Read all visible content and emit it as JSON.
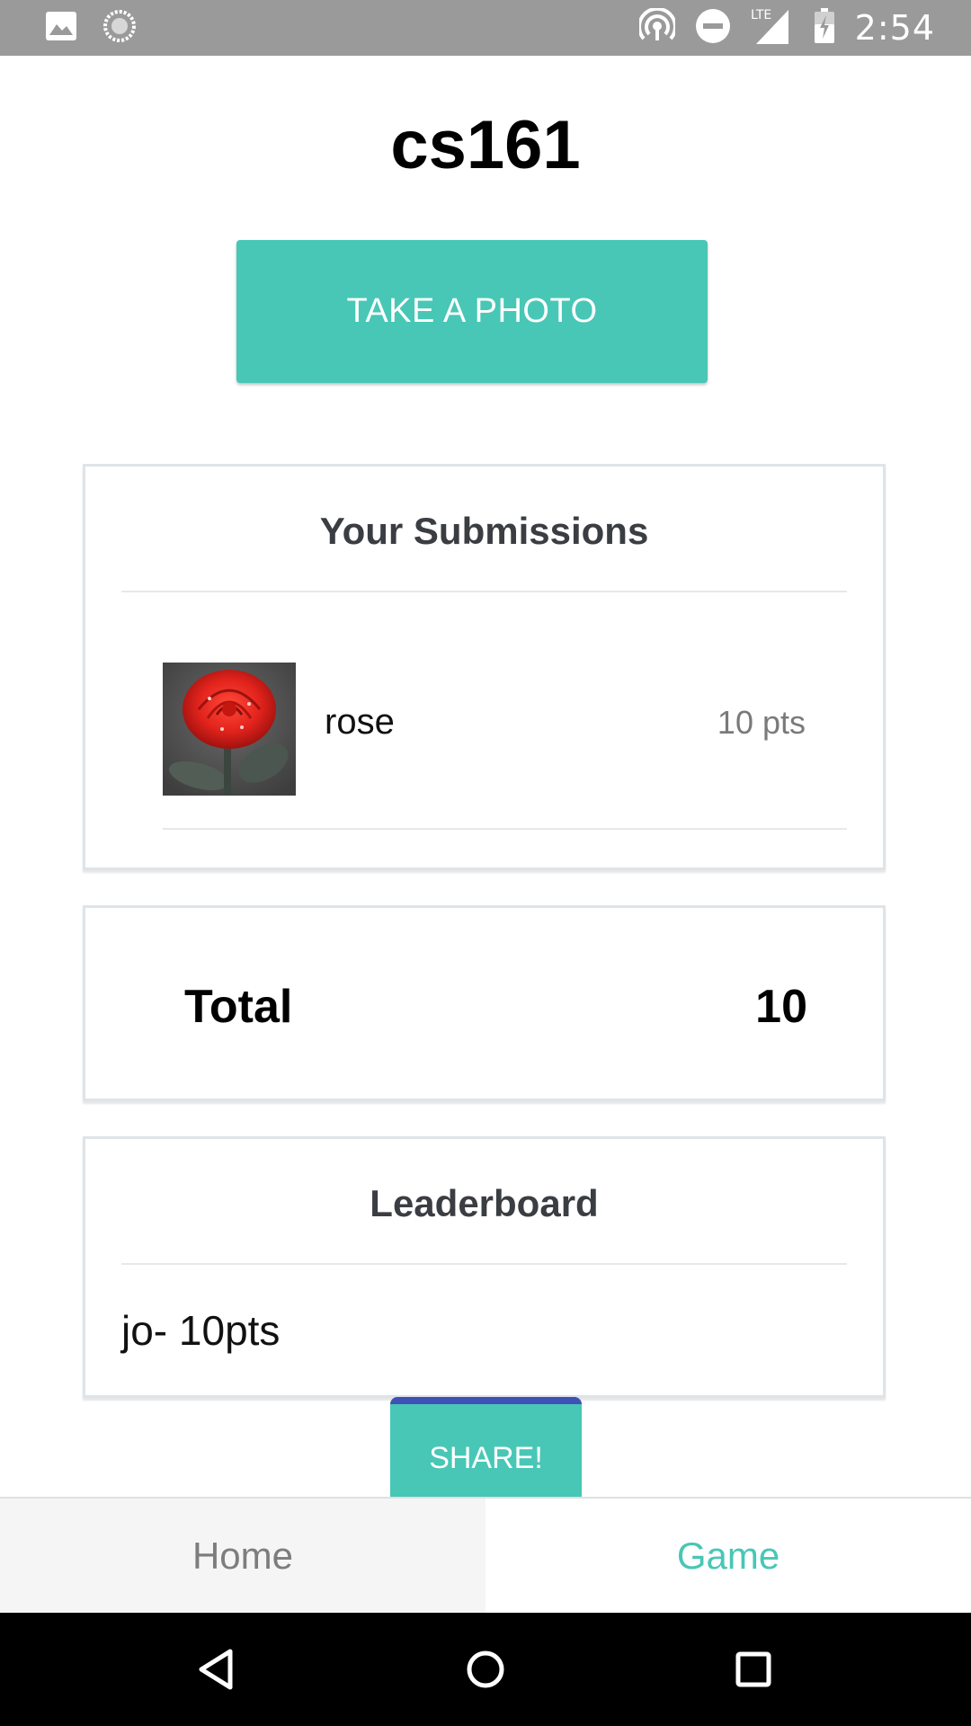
{
  "status_bar": {
    "time": "2:54",
    "network_label": "LTE",
    "left_icons": [
      "image-icon",
      "sync-icon"
    ],
    "right_icons": [
      "hotspot-icon",
      "dnd-icon",
      "signal-icon",
      "battery-icon"
    ]
  },
  "title": "cs161",
  "take_photo_label": "TAKE A PHOTO",
  "submissions": {
    "title": "Your Submissions",
    "items": [
      {
        "name": "rose",
        "points": "10 pts",
        "thumb_icon": "rose-photo"
      }
    ]
  },
  "total": {
    "label": "Total",
    "value": "10"
  },
  "leaderboard": {
    "title": "Leaderboard",
    "entries": [
      "jo- 10pts"
    ]
  },
  "share_label": "SHARE!",
  "tabs": [
    {
      "label": "Home",
      "active": false
    },
    {
      "label": "Game",
      "active": true
    }
  ],
  "colors": {
    "accent": "#48c7b6",
    "share_top": "#3f51b5",
    "status_bar": "#9a9a9a",
    "nav_bar": "#000000"
  },
  "nav_icons": [
    "back-icon",
    "home-circle-icon",
    "recents-icon"
  ]
}
